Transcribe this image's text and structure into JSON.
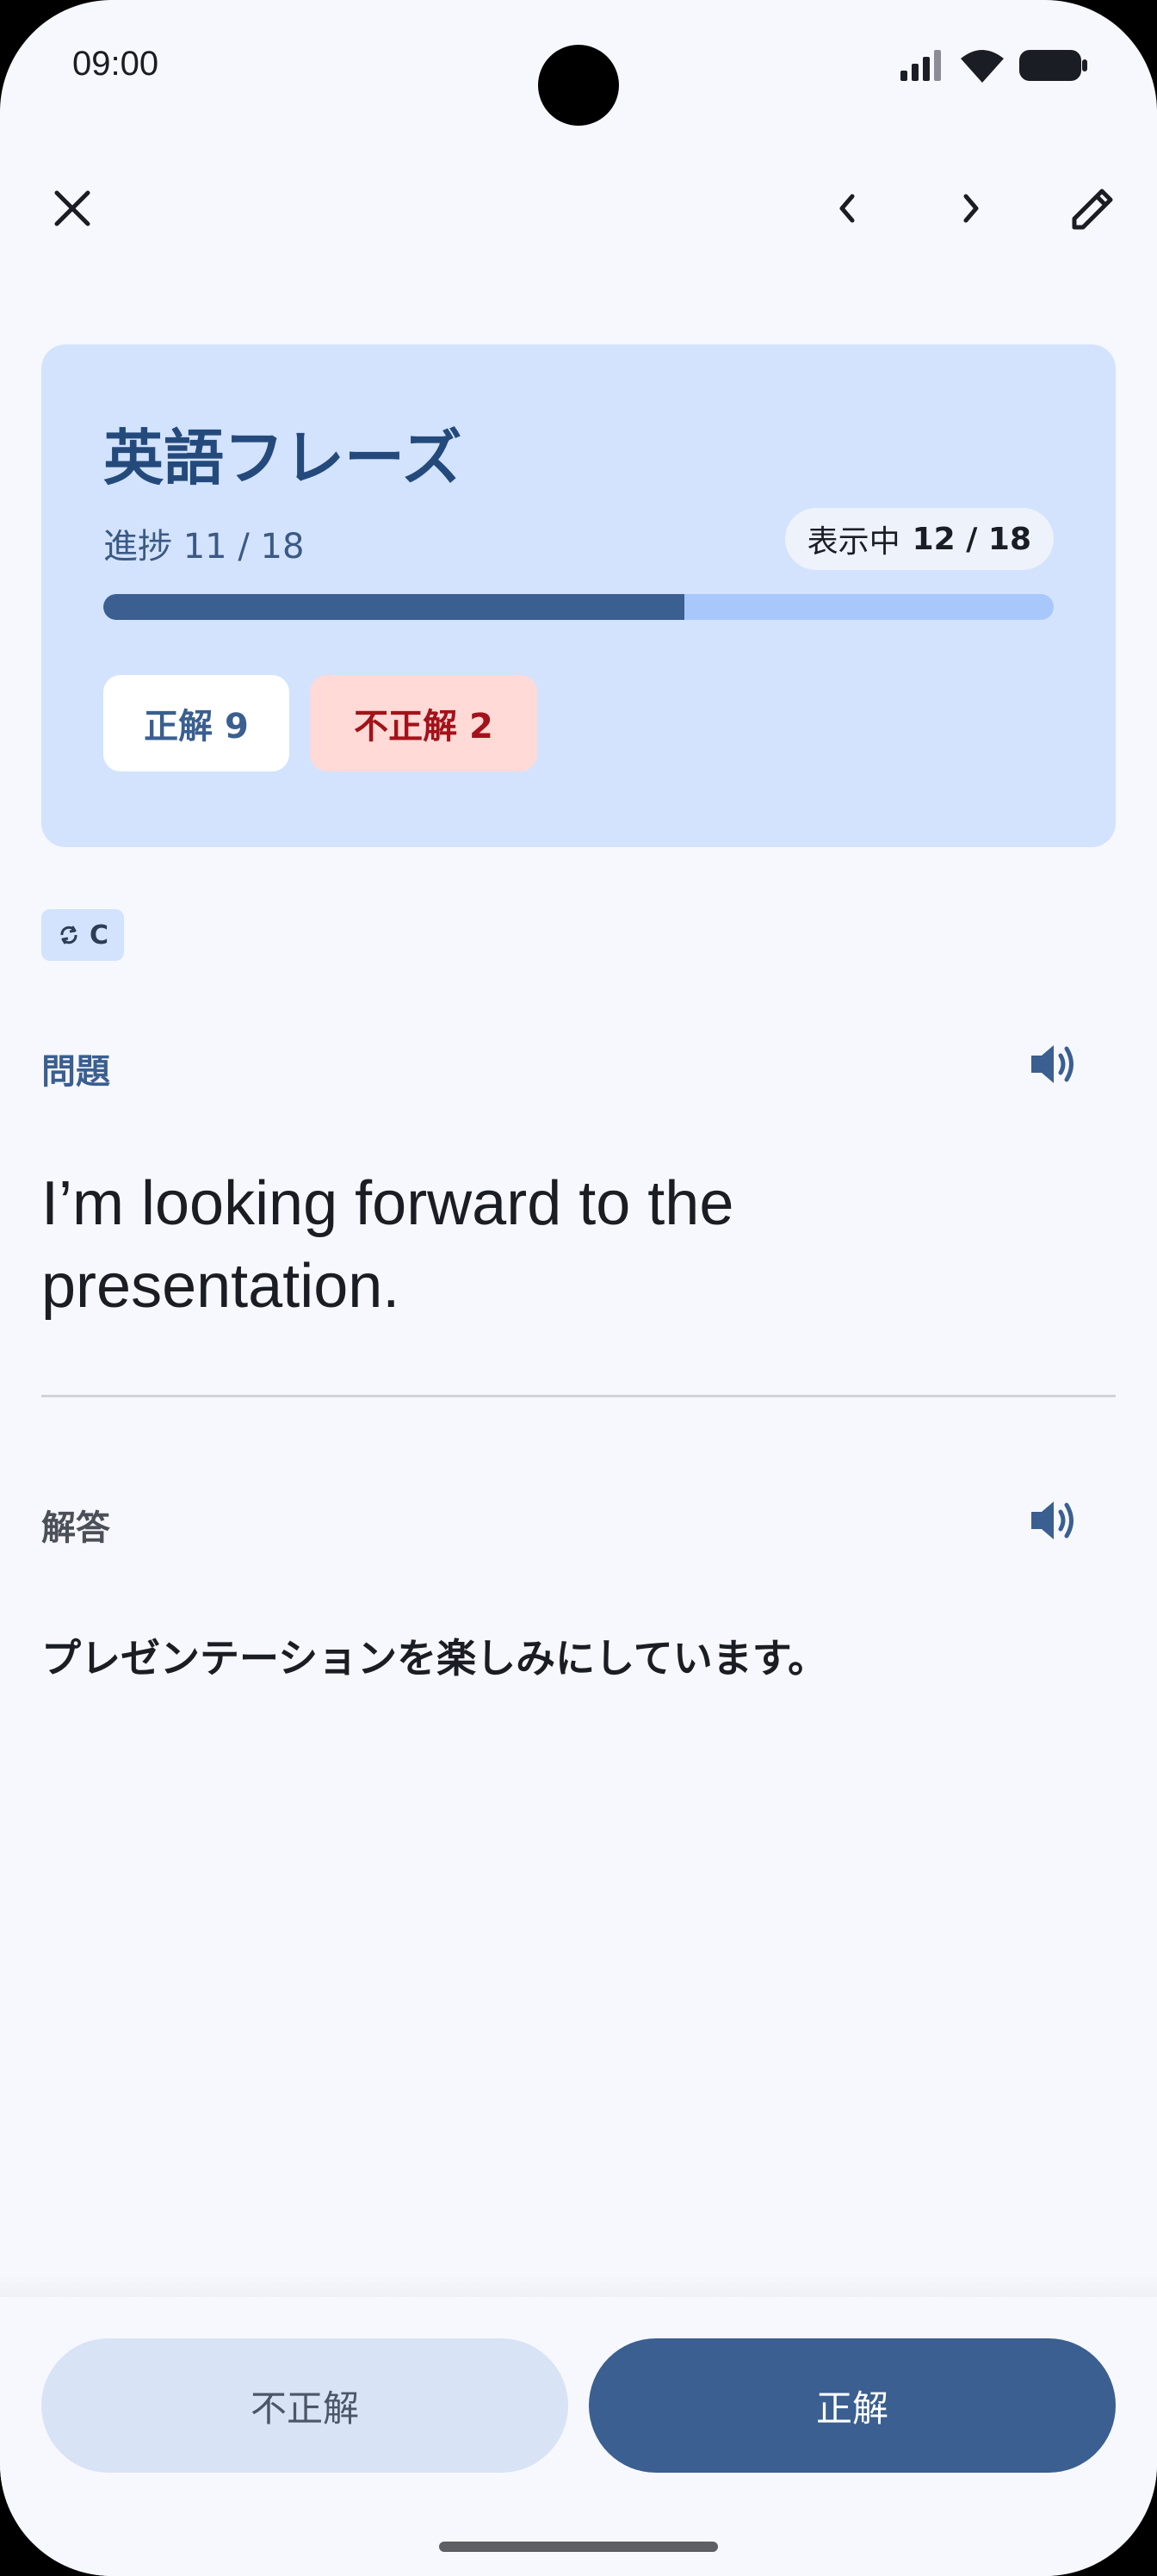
{
  "status_bar": {
    "time": "09:00"
  },
  "card": {
    "title": "英語フレーズ",
    "progress_label": "進捗 11 / 18",
    "progress_fraction": 0.611,
    "showing_label": "表示中",
    "showing_value": "12 / 18",
    "correct_chip": "正解 9",
    "wrong_chip": "不正解 2"
  },
  "tag": {
    "label": "C"
  },
  "question": {
    "label": "問題",
    "text": "I’m looking forward to the presentation."
  },
  "answer": {
    "label": "解答",
    "text": "プレゼンテーションを楽しみにしています。"
  },
  "actions": {
    "wrong_label": "不正解",
    "correct_label": "正解"
  },
  "colors": {
    "accent": "#3a5f90",
    "card_bg": "#d3e3fd",
    "wrong_chip_bg": "#ffdad6",
    "wrong_chip_text": "#a3121a"
  },
  "icons": [
    "close-icon",
    "chevron-left-icon",
    "chevron-right-icon",
    "edit-pencil-icon",
    "repeat-icon",
    "speaker-icon"
  ]
}
